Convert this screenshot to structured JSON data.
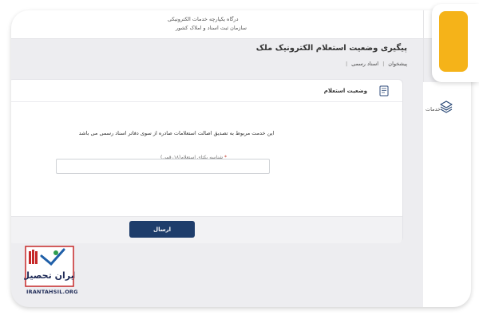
{
  "portal": {
    "line1": "درگاه یکپارچه خدمات الکترونیکی",
    "line2": "سازمان ثبت اسناد و املاک کشور"
  },
  "page": {
    "title": "پیگیری وضعیت استعلام الکترونیک ملک",
    "breadcrumb": [
      "پیشخوان",
      "|",
      "اسناد رسمی",
      "|"
    ]
  },
  "card": {
    "title": "وضعیت استعلام",
    "description": "این خدمت مربوط به تصدیق اصالت استعلامات صادره از سوی دفاتر اسناد رسمی می باشد",
    "field_label": "شناسه یکتای استعلام(۱۸رقمی)",
    "field_required_mark": "*",
    "field_value": "",
    "submit_label": "ارسال"
  },
  "sidebar": {
    "services_label": "خدمات"
  },
  "watermark": {
    "caption": "IRANTAHSIL.ORG",
    "logo_text": "ایران تحصیل"
  },
  "colors": {
    "primary": "#1e3d6b",
    "accent": "#f5b319",
    "required": "#c0392b"
  }
}
